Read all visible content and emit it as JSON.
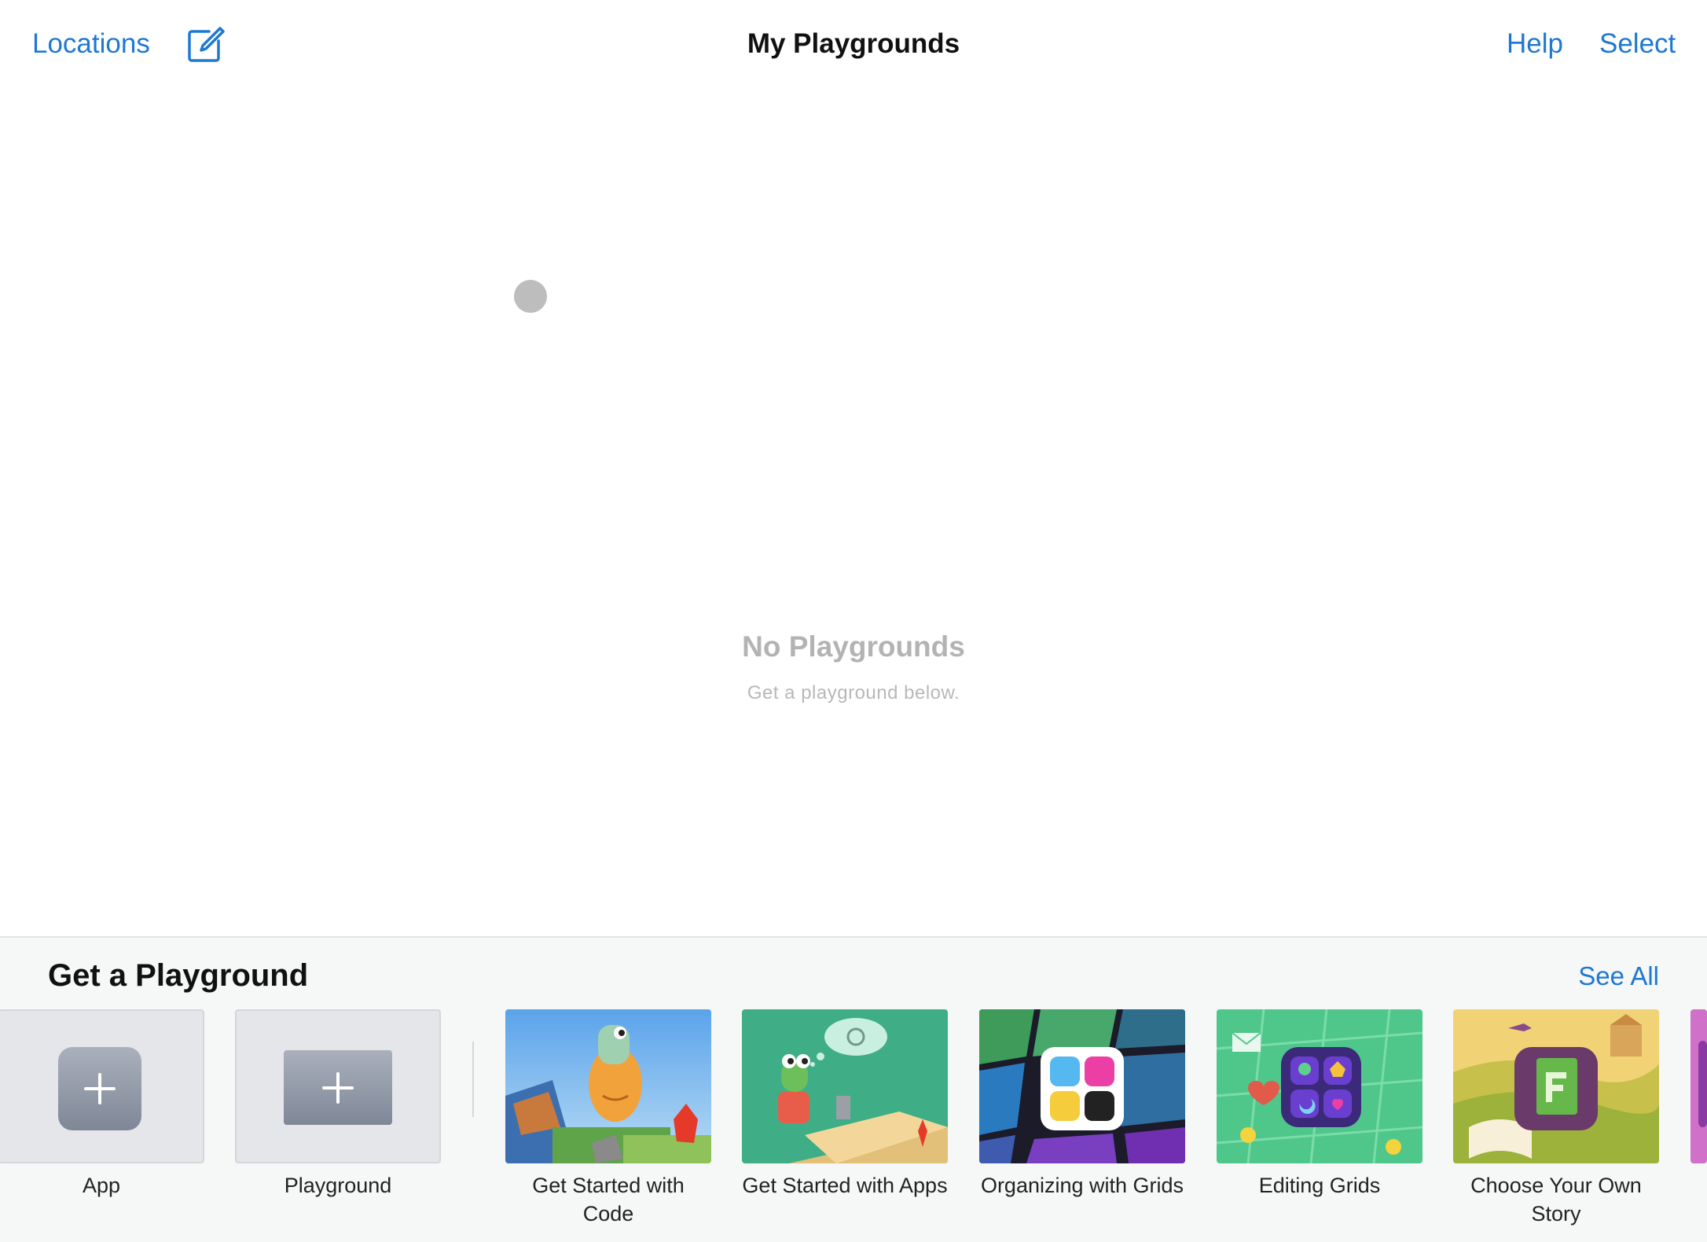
{
  "nav": {
    "locations_label": "Locations",
    "title": "My Playgrounds",
    "help_label": "Help",
    "select_label": "Select"
  },
  "empty_state": {
    "title": "No Playgrounds",
    "subtitle": "Get a playground below."
  },
  "shelf": {
    "title": "Get a Playground",
    "see_all_label": "See All",
    "items": [
      {
        "label": "App",
        "icon": "plus-icon"
      },
      {
        "label": "Playground",
        "icon": "plus-icon"
      },
      {
        "label": "Get Started with Code",
        "icon": "character-thumbnail"
      },
      {
        "label": "Get Started with Apps",
        "icon": "character-thumbnail"
      },
      {
        "label": "Organizing with Grids",
        "icon": "grid-thumbnail"
      },
      {
        "label": "Editing Grids",
        "icon": "grid-thumbnail"
      },
      {
        "label": "Choose Your Own Story",
        "icon": "book-thumbnail"
      }
    ]
  },
  "colors": {
    "accent": "#1f78d1",
    "background": "#ffffff",
    "shelf_background": "#f6f7f7"
  }
}
